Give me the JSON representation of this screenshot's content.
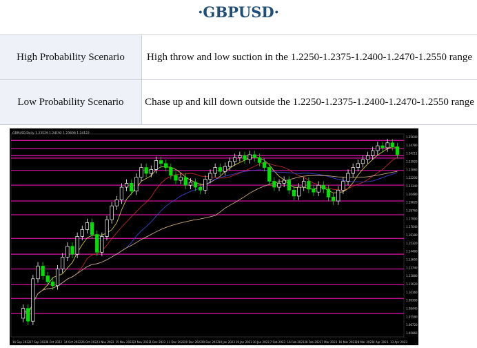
{
  "header": {
    "title": "·GBPUSD·"
  },
  "scenarios": [
    {
      "label": "High Probability Scenario",
      "text": "High throw and low suction in the 1.2250-1.2375-1.2400-1.2470-1.2550 range"
    },
    {
      "label": "Low Probability Scenario",
      "text": "Chase up and kill down outside the 1.2250-1.2375-1.2400-1.2470-1.2550 range"
    }
  ],
  "chart_data": {
    "type": "candlestick",
    "header_text": "GBPUSD,Daily  1.23529 1.24192 1.23608 1.24122",
    "price_axis": [
      "1.25640",
      "1.24780",
      "1.24211",
      "1.23920",
      "1.23060",
      "1.22200",
      "1.21340",
      "1.20480",
      "1.19620",
      "1.18760",
      "1.17900",
      "1.17040",
      "1.16180",
      "1.15320",
      "1.14460",
      "1.13600",
      "1.12740",
      "1.11880",
      "1.11020",
      "1.10160",
      "1.09300",
      "1.08440",
      "1.07580",
      "1.06720",
      "1.05860"
    ],
    "date_axis": [
      "16 Sep 2022",
      "27 Sep 2022",
      "6 Oct 2022",
      "14 Oct 2022",
      "26 Oct 2022",
      "3 Nov 2022",
      "15 Nov 2022",
      "22 Nov 2022",
      "1 Dec 2022",
      "11 Dec 2022",
      "20 Dec 2022",
      "30 Dec 2022",
      "10 Jan 2023",
      "19 Jan 2023",
      "30 Jan 2023",
      "7 Feb 2023",
      "16 Feb 2023",
      "28 Feb 2023",
      "7 Mar 2023",
      "16 Mar 2023",
      "28 Mar 2023",
      "4 Apr 2023",
      "13 Apr 2023"
    ],
    "colors": {
      "background": "#000000",
      "up": "#ffffff",
      "down": "#00e000",
      "level": "#c0108f",
      "ma_fast": "#d4c24a",
      "ma_mid": "#c02828",
      "ma_slow": "#3a40d0",
      "ma_long": "#c8a878"
    },
    "closes": [
      1.085,
      1.072,
      1.115,
      1.128,
      1.118,
      1.112,
      1.108,
      1.125,
      1.137,
      1.148,
      1.14,
      1.158,
      1.165,
      1.172,
      1.16,
      1.142,
      1.158,
      1.175,
      1.189,
      1.195,
      1.208,
      1.212,
      1.204,
      1.218,
      1.228,
      1.222,
      1.226,
      1.235,
      1.232,
      1.228,
      1.22,
      1.215,
      1.218,
      1.21,
      1.213,
      1.208,
      1.205,
      1.216,
      1.222,
      1.228,
      1.224,
      1.229,
      1.234,
      1.238,
      1.24,
      1.236,
      1.241,
      1.238,
      1.233,
      1.228,
      1.214,
      1.208,
      1.212,
      1.215,
      1.205,
      1.199,
      1.208,
      1.214,
      1.206,
      1.203,
      1.21,
      1.206,
      1.198,
      1.194,
      1.205,
      1.214,
      1.222,
      1.228,
      1.232,
      1.236,
      1.24,
      1.245,
      1.25,
      1.248,
      1.253,
      1.249,
      1.241
    ],
    "levels": [
      1.2555,
      1.247,
      1.24,
      1.2375,
      1.225,
      1.21,
      1.194,
      1.18,
      1.156,
      1.14,
      1.125,
      1.109,
      1.095,
      1.08
    ]
  }
}
